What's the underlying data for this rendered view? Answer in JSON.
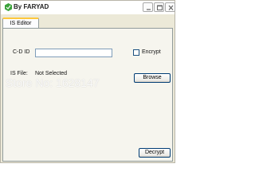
{
  "window": {
    "title": "By FARYAD",
    "icon": "green-app-icon",
    "controls": [
      "minimize-icon",
      "maximize-icon",
      "close-icon"
    ]
  },
  "tabs": [
    {
      "label": "IS Editor",
      "selected": true
    }
  ],
  "form": {
    "cdid_label": "C-D ID",
    "cdid_value": "",
    "encrypt_label": "Encrypt",
    "encrypt_checked": false,
    "isfile_label": "IS File:",
    "isfile_value": "Not Selected",
    "browse_label": "Browse",
    "decrypt_label": "Decrypt"
  },
  "watermark": "Store No: 1628147",
  "colors": {
    "tab_accent": "#ffc83c",
    "button_border": "#003c74",
    "input_border": "#7f9db9"
  }
}
